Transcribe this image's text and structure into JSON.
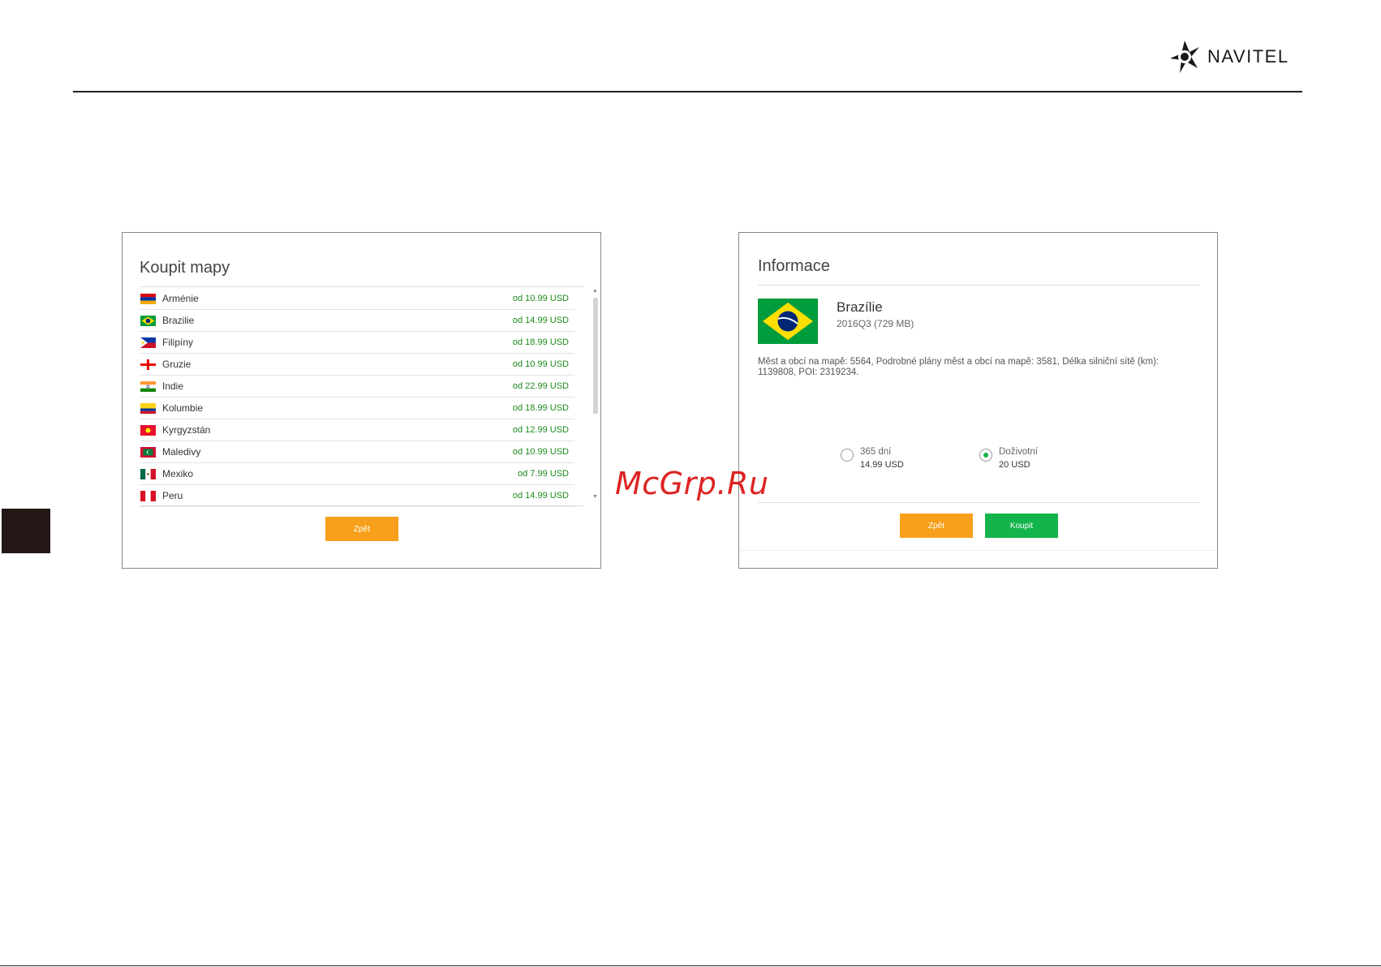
{
  "brand": {
    "name": "NAVITEL"
  },
  "watermark": "McGrp.Ru",
  "buy_maps": {
    "title": "Koupit mapy",
    "items": [
      {
        "country": "Arménie",
        "price": "od 10.99 USD",
        "flag": "armenia-flag-icon"
      },
      {
        "country": "Brazilie",
        "price": "od 14.99 USD",
        "flag": "brazil-flag-icon"
      },
      {
        "country": "Filipíny",
        "price": "od 18.99 USD",
        "flag": "philippines-flag-icon"
      },
      {
        "country": "Gruzie",
        "price": "od 10.99 USD",
        "flag": "georgia-flag-icon"
      },
      {
        "country": "Indie",
        "price": "od 22.99 USD",
        "flag": "india-flag-icon"
      },
      {
        "country": "Kolumbie",
        "price": "od 18.99 USD",
        "flag": "colombia-flag-icon"
      },
      {
        "country": "Kyrgyzstán",
        "price": "od 12.99 USD",
        "flag": "kyrgyzstan-flag-icon"
      },
      {
        "country": "Maledivy",
        "price": "od 10.99 USD",
        "flag": "maldives-flag-icon"
      },
      {
        "country": "Mexiko",
        "price": "od 7.99 USD",
        "flag": "mexico-flag-icon"
      },
      {
        "country": "Peru",
        "price": "od 14.99 USD",
        "flag": "peru-flag-icon"
      }
    ],
    "back_label": "Zpět"
  },
  "info": {
    "title": "Informace",
    "map_name": "Brazílie",
    "map_meta": "2016Q3 (729 MB)",
    "description": "Měst a obcí na mapě: 5564, Podrobné plány měst a obcí na mapě: 3581, Délka silniční sítě (km): 1139808, POI: 2319234.",
    "options": [
      {
        "label": "365 dní",
        "price": "14.99 USD",
        "selected": false
      },
      {
        "label": "Doživotní",
        "price": "20 USD",
        "selected": true
      }
    ],
    "back_label": "Zpět",
    "buy_label": "Koupit"
  },
  "colors": {
    "accent_orange": "#f8a01c",
    "accent_green": "#12b44b",
    "price_green": "#1a8a1a"
  }
}
